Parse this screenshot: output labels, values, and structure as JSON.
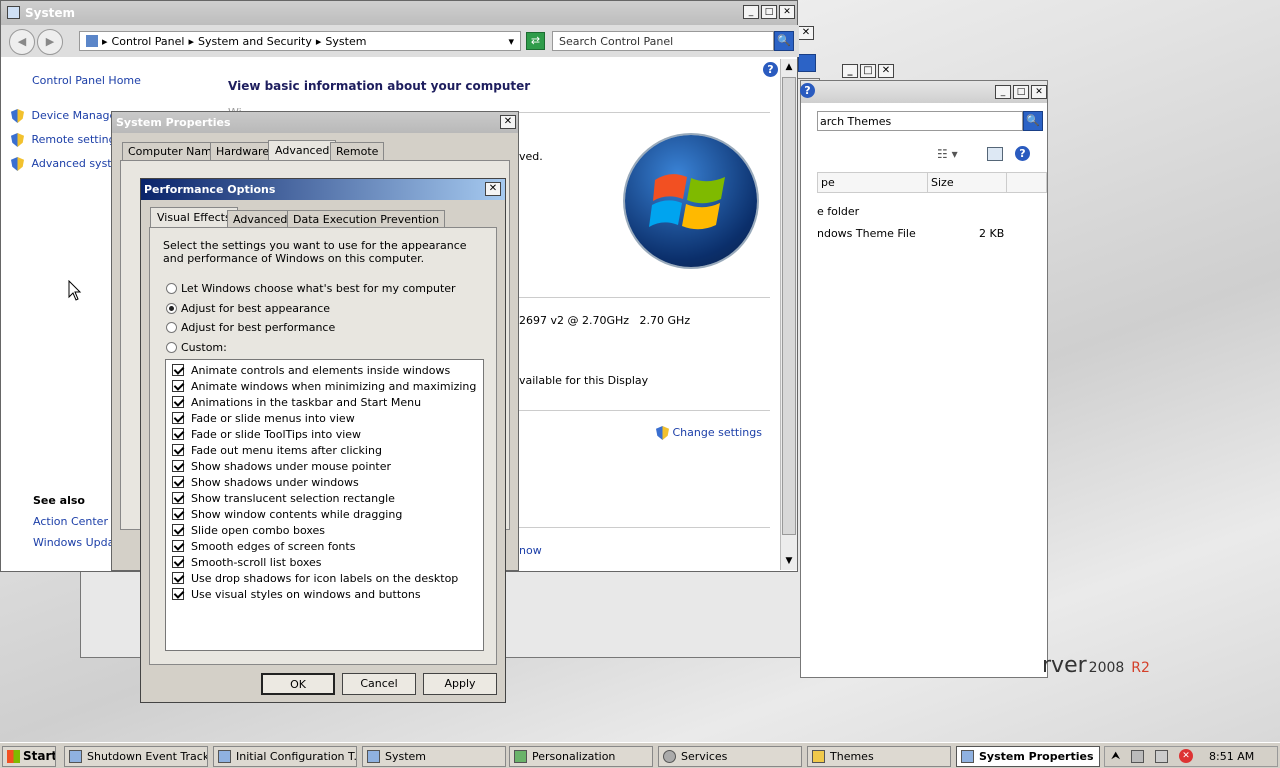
{
  "system": {
    "title": "System",
    "breadcrumb": [
      "Control Panel",
      "System and Security",
      "System"
    ],
    "search_placeholder": "Search Control Panel",
    "heading": "View basic information about your computer",
    "sidebar": {
      "home": "Control Panel Home",
      "items": [
        "Device Manager",
        "Remote settings",
        "Advanced system settings"
      ],
      "see_also_title": "See also",
      "see_also": [
        "Action Center",
        "Windows Update"
      ]
    },
    "frag_reserved": "ved.",
    "frag_cpu": "2697 v2 @ 2.70GHz   2.70 GHz",
    "frag_display": "vailable for this Display",
    "change_settings": "Change settings",
    "frag_now": "now",
    "frag_trunc": "Wi"
  },
  "themes": {
    "search_placeholder": "arch Themes",
    "col_type": "pe",
    "col_size": "Size",
    "rows": [
      {
        "type": "e folder",
        "size": ""
      },
      {
        "type": "ndows Theme File",
        "size": "2 KB"
      }
    ]
  },
  "brand": {
    "text": "rver",
    "ver": "2008",
    "r2": "R2"
  },
  "sysprops": {
    "title": "System Properties",
    "tabs": [
      "Computer Name",
      "Hardware",
      "Advanced",
      "Remote"
    ],
    "selected_tab": "Advanced"
  },
  "perf": {
    "title": "Performance Options",
    "tabs": [
      "Visual Effects",
      "Advanced",
      "Data Execution Prevention"
    ],
    "description": "Select the settings you want to use for the appearance and performance of Windows on this computer.",
    "radios": [
      {
        "label": "Let Windows choose what's best for my computer",
        "selected": false
      },
      {
        "label": "Adjust for best appearance",
        "selected": true
      },
      {
        "label": "Adjust for best performance",
        "selected": false
      },
      {
        "label": "Custom:",
        "selected": false
      }
    ],
    "effects": [
      "Animate controls and elements inside windows",
      "Animate windows when minimizing and maximizing",
      "Animations in the taskbar and Start Menu",
      "Fade or slide menus into view",
      "Fade or slide ToolTips into view",
      "Fade out menu items after clicking",
      "Show shadows under mouse pointer",
      "Show shadows under windows",
      "Show translucent selection rectangle",
      "Show window contents while dragging",
      "Slide open combo boxes",
      "Smooth edges of screen fonts",
      "Smooth-scroll list boxes",
      "Use drop shadows for icon labels on the desktop",
      "Use visual styles on windows and buttons"
    ],
    "buttons": {
      "ok": "OK",
      "cancel": "Cancel",
      "apply": "Apply"
    }
  },
  "taskbar": {
    "start": "Start",
    "items": [
      "Shutdown Event Tracker",
      "Initial Configuration T...",
      "System",
      "Personalization",
      "Services",
      "Themes",
      "System Properties"
    ],
    "active": "System Properties",
    "time": "8:51 AM"
  }
}
